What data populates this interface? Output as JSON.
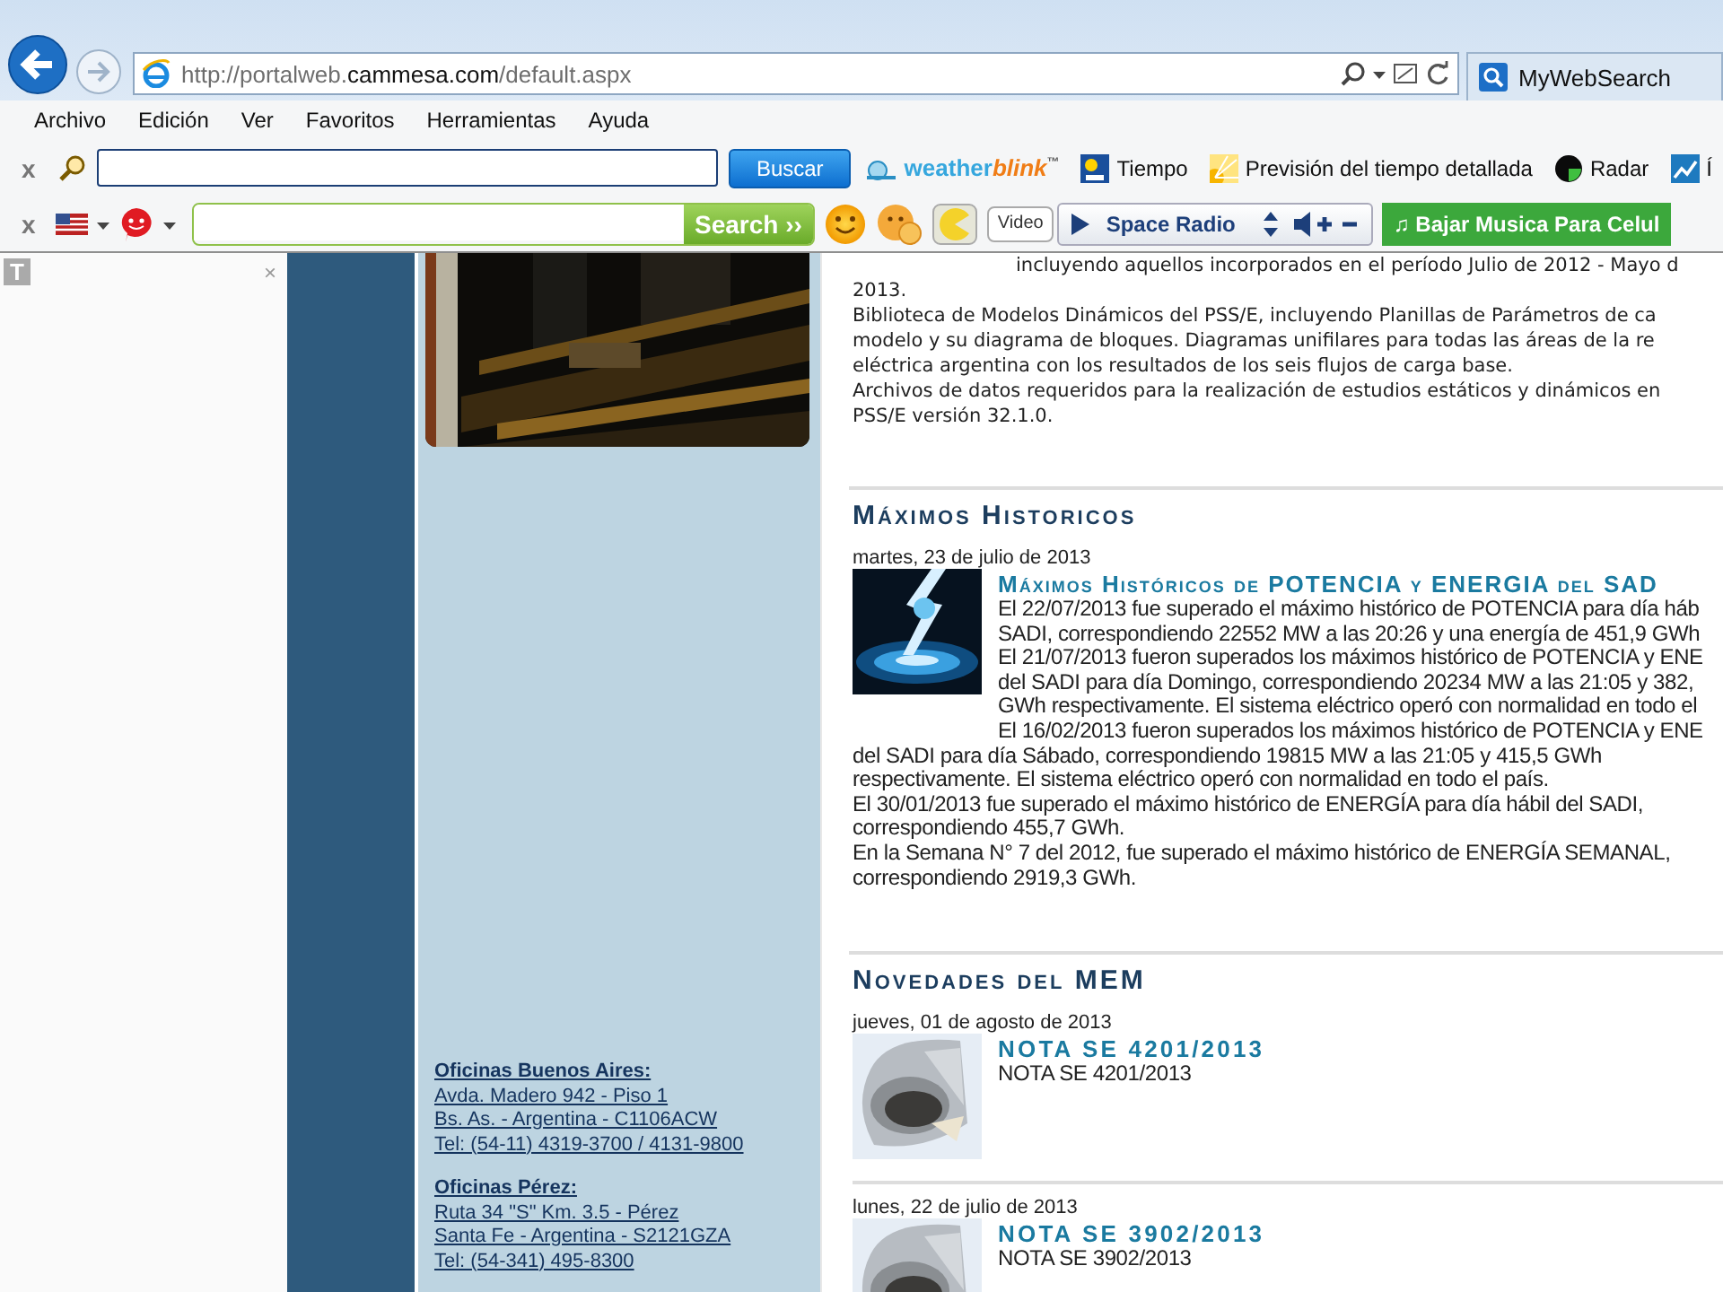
{
  "browser": {
    "url": {
      "prefix": "http://portalweb.",
      "domain": "cammesa.com",
      "path": "/default.aspx"
    },
    "search_tab": "MyWebSearch"
  },
  "menu": [
    "Archivo",
    "Edición",
    "Ver",
    "Favoritos",
    "Herramientas",
    "Ayuda"
  ],
  "toolbar_1": {
    "close": "x",
    "search_button": "Buscar",
    "brand": {
      "first": "weather",
      "second": "blink",
      "mark": "™"
    },
    "links": [
      "Tiempo",
      "Previsión del tiempo detallada",
      "Radar",
      "Í"
    ]
  },
  "toolbar_2": {
    "close": "x",
    "search_button": "Search ››",
    "video_button": "Video",
    "radio_station": "Space Radio",
    "music_button": "♫ Bajar Musica Para Celul"
  },
  "side_panel": {
    "close": "×",
    "icon_letter": "T"
  },
  "offices": [
    {
      "title": "Oficinas Buenos Aires:",
      "lines": [
        "Avda. Madero 942 - Piso 1",
        "Bs. As. - Argentina - C1106ACW",
        "Tel: (54-11) 4319-3700 / 4131-9800"
      ]
    },
    {
      "title": "Oficinas Pérez:",
      "lines": [
        "Ruta 34 \"S\" Km. 3.5 - Pérez",
        "Santa Fe - Argentina - S2121GZA",
        "Tel: (54-341) 495-8300"
      ]
    }
  ],
  "intro": {
    "first_line": "incluyendo aquellos incorporados en el período Julio de 2012 - Mayo d",
    "lines": [
      "2013.",
      "Biblioteca de Modelos Dinámicos del PSS/E, incluyendo Planillas de Parámetros de ca",
      "modelo y su diagrama de bloques. Diagramas unifilares para todas las áreas de la re",
      "eléctrica argentina con los resultados de los seis flujos de carga base.",
      "Archivos de datos requeridos para la realización de estudios estáticos y dinámicos en",
      "PSS/E versión 32.1.0."
    ]
  },
  "maximos": {
    "heading": "Máximos Historicos",
    "date": "martes, 23 de julio de 2013",
    "headline": "Máximos Históricos de POTENCIA y ENERGIA del SAD",
    "lines_beside": [
      "El 22/07/2013 fue superado el máximo histórico de POTENCIA para día háb",
      "SADI, correspondiendo 22552 MW a las 20:26 y una energía de 451,9 GWh",
      "El 21/07/2013 fueron superados los máximos histórico de POTENCIA y ENE",
      "del SADI para día Domingo, correspondiendo  20234 MW a las 21:05 y 382,",
      "GWh respectivamente. El sistema eléctrico operó con normalidad en todo el",
      "El 16/02/2013 fueron superados los máximos histórico de POTENCIA y ENE"
    ],
    "lines_below": [
      "del SADI para día Sábado, correspondiendo  19815 MW a las 21:05 y 415,5 GWh",
      "respectivamente. El sistema eléctrico operó con normalidad en todo el país.",
      "El 30/01/2013 fue superado el máximo histórico de ENERGÍA para día hábil del SADI,",
      "correspondiendo 455,7 GWh.",
      "En la Semana N° 7 del 2012, fue superado el máximo histórico de ENERGÍA SEMANAL,",
      "correspondiendo 2919,3 GWh."
    ]
  },
  "novedades": {
    "heading": "Novedades del MEM",
    "items": [
      {
        "date": "jueves, 01 de agosto de 2013",
        "title": "NOTA SE 4201/2013",
        "text": "NOTA SE 4201/2013"
      },
      {
        "date": "lunes, 22 de julio de 2013",
        "title": "NOTA SE 3902/2013",
        "text": "NOTA SE 3902/2013"
      }
    ]
  }
}
